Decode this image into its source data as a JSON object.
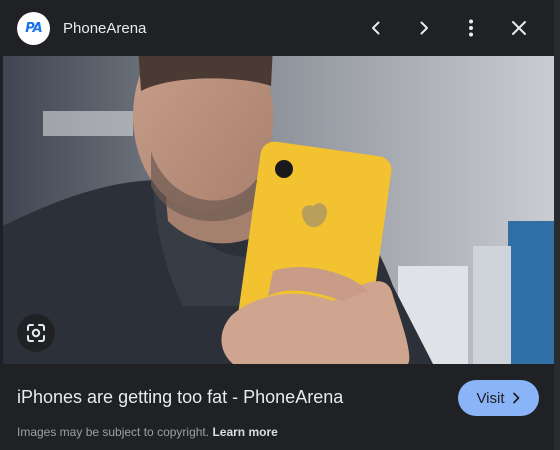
{
  "header": {
    "logo_text": "PA",
    "site_name": "PhoneArena",
    "icons": [
      "chevron-left-icon",
      "chevron-right-icon",
      "more-vert-icon",
      "close-icon"
    ]
  },
  "image": {
    "description_icon": "google-lens-icon"
  },
  "caption": {
    "title": "iPhones are getting too fat - PhoneArena",
    "visit_label": "Visit",
    "copyright_text": "Images may be subject to copyright.",
    "learn_more": "Learn more"
  },
  "colors": {
    "background": "#202124",
    "accent": "#8ab4f8",
    "phone": "#f2c230"
  }
}
